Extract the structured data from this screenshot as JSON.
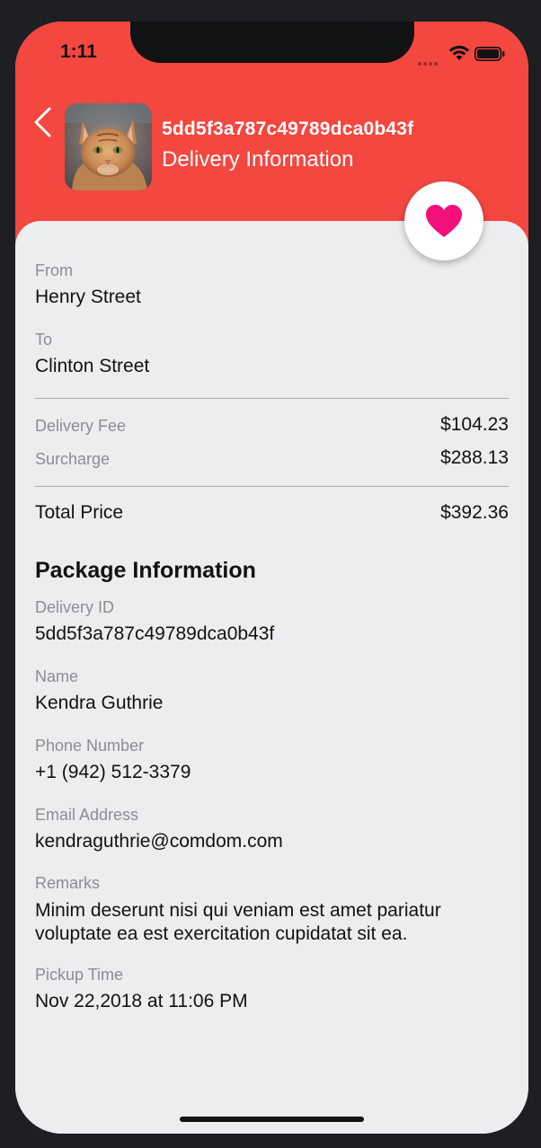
{
  "status_bar": {
    "time": "1:11"
  },
  "header": {
    "delivery_id": "5dd5f3a787c49789dca0b43f",
    "subtitle": "Delivery Information"
  },
  "route": {
    "from_label": "From",
    "from_value": "Henry Street",
    "to_label": "To",
    "to_value": "Clinton Street"
  },
  "pricing": {
    "delivery_fee_label": "Delivery Fee",
    "delivery_fee_value": "$104.23",
    "surcharge_label": "Surcharge",
    "surcharge_value": "$288.13",
    "total_label": "Total Price",
    "total_value": "$392.36"
  },
  "package": {
    "section_title": "Package Information",
    "delivery_id_label": "Delivery ID",
    "delivery_id_value": "5dd5f3a787c49789dca0b43f",
    "name_label": "Name",
    "name_value": "Kendra Guthrie",
    "phone_label": "Phone Number",
    "phone_value": "+1 (942) 512-3379",
    "email_label": "Email Address",
    "email_value": "kendraguthrie@comdom.com",
    "remarks_label": "Remarks",
    "remarks_value": "Minim deserunt nisi qui veniam est amet pariatur voluptate ea est exercitation cupidatat sit ea.",
    "pickup_label": "Pickup Time",
    "pickup_value": "Nov 22,2018 at 11:06 PM"
  },
  "icons": {
    "back": "chevron-left-icon",
    "favorite": "heart-icon",
    "wifi": "wifi-icon",
    "battery": "battery-icon",
    "signal": "cellular-signal-icon"
  },
  "colors": {
    "header_bg": "#f34740",
    "heart": "#f4107a",
    "card_bg": "#ecedef",
    "label": "#8c8d90",
    "value": "#111214"
  }
}
